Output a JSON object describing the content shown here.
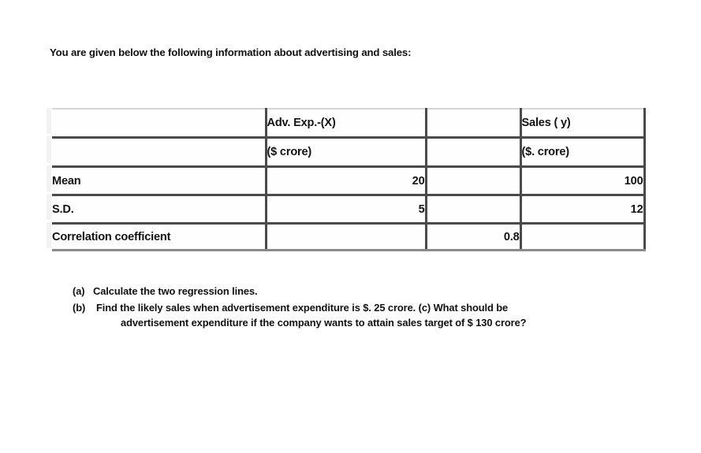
{
  "document": {
    "intro": "You are given below the following information about advertising and sales:",
    "table": {
      "columns": [
        {
          "key": "label",
          "header_line1": "",
          "header_line2": ""
        },
        {
          "key": "x",
          "header_line1": "Adv. Exp.-(X)",
          "header_line2": "($ crore)"
        },
        {
          "key": "middle",
          "header_line1": "",
          "header_line2": ""
        },
        {
          "key": "y",
          "header_line1": "Sales ( y)",
          "header_line2": "($. crore)"
        }
      ],
      "rows": [
        {
          "label": "Mean",
          "x": "20",
          "middle": "",
          "y": "100"
        },
        {
          "label": "S.D.",
          "x": "5",
          "middle": "",
          "y": "12"
        },
        {
          "label": "Correlation coefficient",
          "x": "",
          "middle": "0.8",
          "y": ""
        }
      ]
    },
    "questions": [
      {
        "tag": "(a)",
        "line1": "Calculate the two regression lines.",
        "line2": ""
      },
      {
        "tag": "(b)",
        "line1": "Find the likely sales when advertisement expenditure is $. 25 crore. (c) What should be",
        "line2": "advertisement expenditure if the company wants to attain sales target of $ 130 crore?"
      }
    ]
  },
  "colors": {
    "page_background": "#ffffff",
    "text": "#111111",
    "table_rule": "#4a4a4a",
    "table_rule_light": "#d6d6d6"
  }
}
